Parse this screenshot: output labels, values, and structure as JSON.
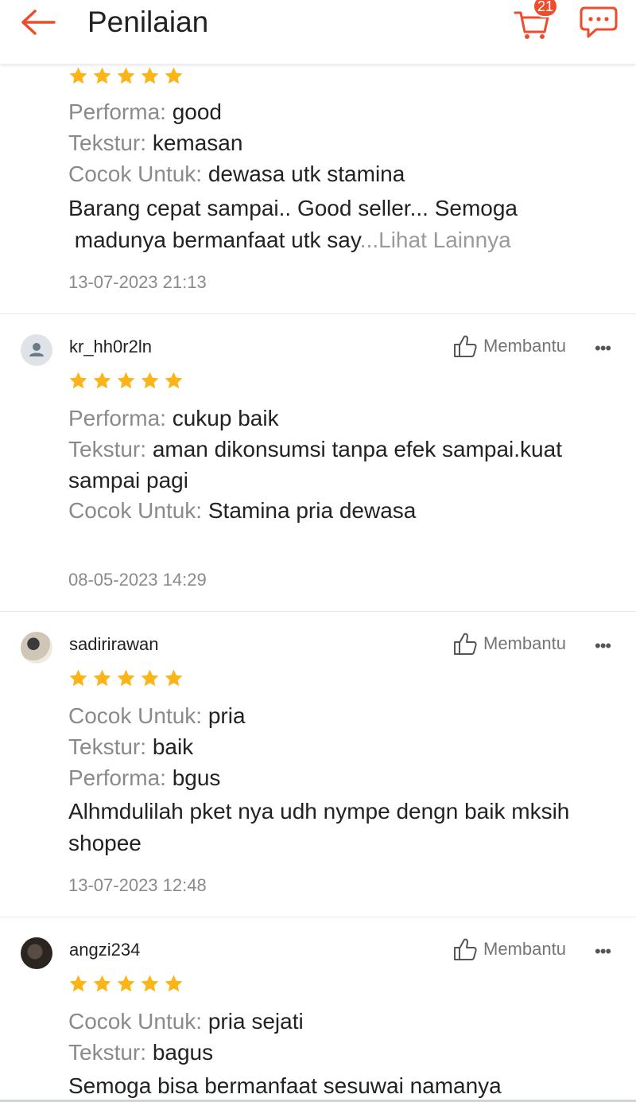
{
  "header": {
    "title": "Penilaian",
    "cart_count": "21",
    "accent_color": "#ee4d2d",
    "icons": [
      "back-arrow-icon",
      "cart-icon",
      "chat-icon"
    ]
  },
  "reviews": [
    {
      "stars": 5,
      "attributes": [
        {
          "key": "Performa:",
          "value": "good"
        },
        {
          "key": "Tekstur:",
          "value": "kemasan"
        },
        {
          "key": "Cocok Untuk:",
          "value": "dewasa utk stamina"
        }
      ],
      "text_line1": "Barang cepat sampai.. Good seller... Semoga",
      "text_line2": " madunya bermanfaat utk say",
      "more_label": "...Lihat Lainnya",
      "date": "13-07-2023 21:13"
    },
    {
      "username": "kr_hh0r2ln",
      "helpful_label": "Membantu",
      "stars": 5,
      "attributes": [
        {
          "key": "Performa:",
          "value": "cukup baik"
        },
        {
          "key": "Tekstur:",
          "value": "aman dikonsumsi tanpa efek sampai.kuat"
        },
        {
          "key": "",
          "value": "sampai pagi"
        },
        {
          "key": "Cocok Untuk:",
          "value": "Stamina pria dewasa"
        }
      ],
      "date": "08-05-2023 14:29"
    },
    {
      "username": "sadirirawan",
      "helpful_label": "Membantu",
      "stars": 5,
      "attributes": [
        {
          "key": "Cocok Untuk:",
          "value": "pria"
        },
        {
          "key": "Tekstur:",
          "value": "baik"
        },
        {
          "key": "Performa:",
          "value": "bgus"
        }
      ],
      "text": "Alhmdulilah pket nya udh nympe dengn baik mksih shopee",
      "date": "13-07-2023 12:48"
    },
    {
      "username": "angzi234",
      "helpful_label": "Membantu",
      "stars": 5,
      "attributes": [
        {
          "key": "Cocok Untuk:",
          "value": "pria sejati"
        },
        {
          "key": "Tekstur:",
          "value": "bagus"
        }
      ],
      "text": "Semoga bisa bermanfaat sesuwai namanya"
    }
  ],
  "colors": {
    "star": "#fcb416",
    "attr_key": "#8a8a8a",
    "muted": "#8a8a8a"
  }
}
